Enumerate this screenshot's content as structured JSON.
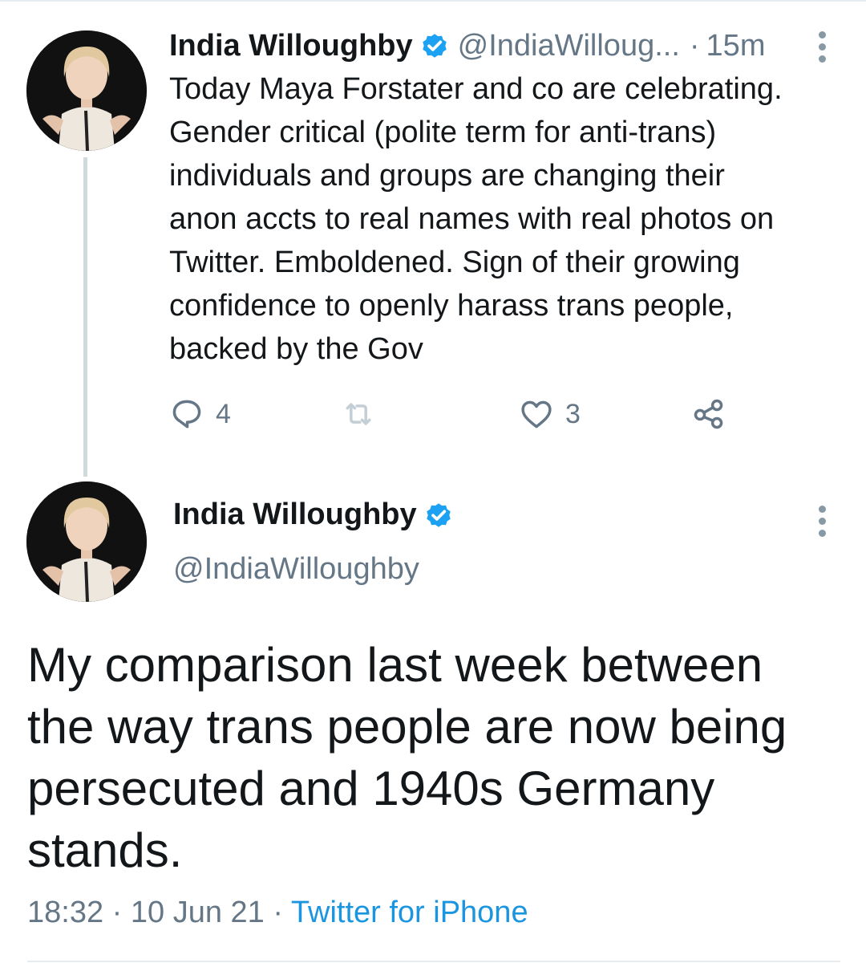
{
  "tweet1": {
    "name": "India Willoughby",
    "handle": "@IndiaWilloug...",
    "separator": "·",
    "time": "15m",
    "lines": [
      "Today Maya Forstater and co are celebrating.",
      "Gender critical (polite term for anti-trans)",
      "individuals and groups are changing their",
      "anon accts to real names with real photos on",
      "Twitter. Emboldened. Sign of their growing",
      "confidence to openly harass trans people,",
      "backed by the Gov"
    ],
    "reply_count": "4",
    "like_count": "3"
  },
  "tweet2": {
    "name": "India Willoughby",
    "handle": "@IndiaWilloughby",
    "lines": [
      "My comparison last week between",
      "the way trans people are now being",
      "persecuted and 1940s Germany",
      "stands."
    ],
    "time": "18:32",
    "date": "10 Jun 21",
    "source": "Twitter for iPhone",
    "separator": "·"
  },
  "icons": {
    "verified": "verified-badge-icon",
    "reply": "reply-icon",
    "retweet": "retweet-icon",
    "like": "like-icon",
    "share": "share-icon",
    "more": "more-options-icon"
  },
  "colors": {
    "verified": "#1da1f2",
    "link": "#1b95e0",
    "muted": "#657786",
    "text": "#14171a"
  }
}
